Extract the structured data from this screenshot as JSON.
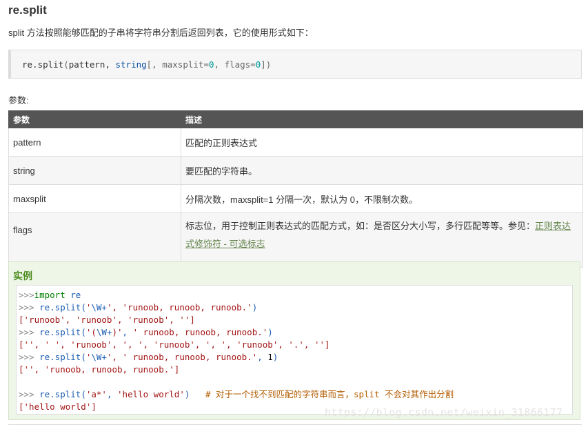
{
  "header": {
    "title": "re.split",
    "intro": "split 方法按照能够匹配的子串将字符串分割后返回列表，它的使用形式如下："
  },
  "syntax": {
    "fn": "re.split",
    "open": "(",
    "arg1": "pattern",
    "sep1": ", ",
    "arg2": "string",
    "rest": "[, maxsplit",
    "eq1": "=",
    "v1": "0",
    "sep2": ", flags",
    "eq2": "=",
    "v2": "0",
    "close": "])"
  },
  "params": {
    "label": "参数:",
    "columns": [
      "参数",
      "描述"
    ],
    "rows": [
      {
        "name": "pattern",
        "desc": "匹配的正则表达式"
      },
      {
        "name": "string",
        "desc": "要匹配的字符串。"
      },
      {
        "name": "maxsplit",
        "desc": "分隔次数，maxsplit=1 分隔一次，默认为 0，不限制次数。"
      },
      {
        "name": "flags",
        "desc": "标志位，用于控制正则表达式的匹配方式，如：是否区分大小写，多行匹配等等。参见：",
        "link": "正则表达式修饰符 - 可选标志"
      }
    ]
  },
  "example": {
    "title": "实例",
    "lines": [
      [
        {
          "t": ">>>",
          "c": "c-prompt"
        },
        {
          "t": "import",
          "c": "c-kw"
        },
        {
          "t": " re",
          "c": "c-fn"
        }
      ],
      [
        {
          "t": ">>> ",
          "c": "c-prompt"
        },
        {
          "t": "re.split(",
          "c": "c-fn"
        },
        {
          "t": "'",
          "c": "c-str"
        },
        {
          "t": "\\W+",
          "c": "c-fn"
        },
        {
          "t": "', ",
          "c": "c-str"
        },
        {
          "t": "'runoob, runoob, runoob.'",
          "c": "c-str"
        },
        {
          "t": ")",
          "c": "c-fn"
        }
      ],
      [
        {
          "t": "['runoob', 'runoob', 'runoob', '']",
          "c": "c-out"
        }
      ],
      [
        {
          "t": ">>> ",
          "c": "c-prompt"
        },
        {
          "t": "re.split(",
          "c": "c-fn"
        },
        {
          "t": "'(",
          "c": "c-str"
        },
        {
          "t": "\\W+",
          "c": "c-fn"
        },
        {
          "t": ")'",
          "c": "c-str"
        },
        {
          "t": ", ",
          "c": "c-fn"
        },
        {
          "t": "' runoob, runoob, runoob.'",
          "c": "c-str"
        },
        {
          "t": ")",
          "c": "c-fn"
        }
      ],
      [
        {
          "t": "['', ' ', 'runoob', ', ', 'runoob', ', ', 'runoob', '.', '']",
          "c": "c-out"
        }
      ],
      [
        {
          "t": ">>> ",
          "c": "c-prompt"
        },
        {
          "t": "re.split(",
          "c": "c-fn"
        },
        {
          "t": "'",
          "c": "c-str"
        },
        {
          "t": "\\W+",
          "c": "c-fn"
        },
        {
          "t": "', ",
          "c": "c-str"
        },
        {
          "t": "' runoob, runoob, runoob.'",
          "c": "c-str"
        },
        {
          "t": ", ",
          "c": "c-fn"
        },
        {
          "t": "1",
          "c": "c-dark"
        },
        {
          "t": ")",
          "c": "c-fn"
        }
      ],
      [
        {
          "t": "['', 'runoob, runoob, runoob.']",
          "c": "c-out"
        }
      ],
      [
        {
          "t": "",
          "c": "c-out"
        }
      ],
      [
        {
          "t": ">>> ",
          "c": "c-prompt"
        },
        {
          "t": "re.split(",
          "c": "c-fn"
        },
        {
          "t": "'a*'",
          "c": "c-str"
        },
        {
          "t": ", ",
          "c": "c-fn"
        },
        {
          "t": "'hello world'",
          "c": "c-str"
        },
        {
          "t": ")   ",
          "c": "c-fn"
        },
        {
          "t": "# 对于一个找不到匹配的字符串而言，split 不会对其作出分割",
          "c": "c-cmt"
        }
      ],
      [
        {
          "t": "['hello world']",
          "c": "c-out"
        }
      ]
    ]
  },
  "watermark": "https://blog.csdn.net/weixin_31866177"
}
